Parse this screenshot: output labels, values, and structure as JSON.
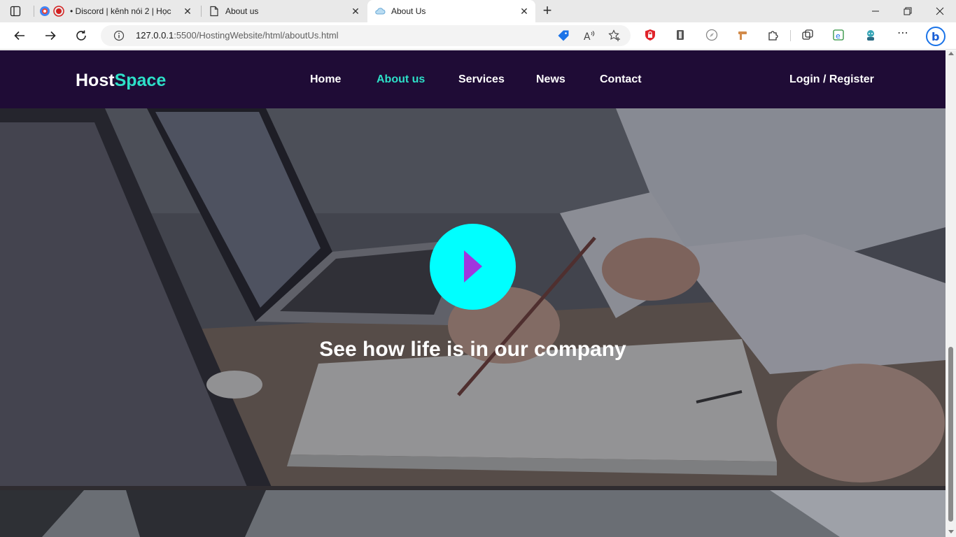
{
  "browser": {
    "tabs": [
      {
        "title": "• Discord | kênh nói 2 | Học",
        "active": false
      },
      {
        "title": "About us",
        "active": false
      },
      {
        "title": "About Us",
        "active": true
      }
    ],
    "address_bar": {
      "url_host": "127.0.0.1",
      "url_path": ":5500/HostingWebsite/html/aboutUs.html"
    }
  },
  "site": {
    "logo": {
      "part1": "Host",
      "part2": "Space"
    },
    "nav": [
      {
        "label": "Home",
        "active": false
      },
      {
        "label": "About us",
        "active": true
      },
      {
        "label": "Services",
        "active": false
      },
      {
        "label": "News",
        "active": false
      },
      {
        "label": "Contact",
        "active": false
      }
    ],
    "auth_link": "Login / Register",
    "hero": {
      "caption": "See how life is in our company"
    }
  },
  "colors": {
    "header_bg": "#1f0c36",
    "accent": "#2de0c8",
    "play_button": "#00ffff",
    "play_icon": "#a036de"
  }
}
